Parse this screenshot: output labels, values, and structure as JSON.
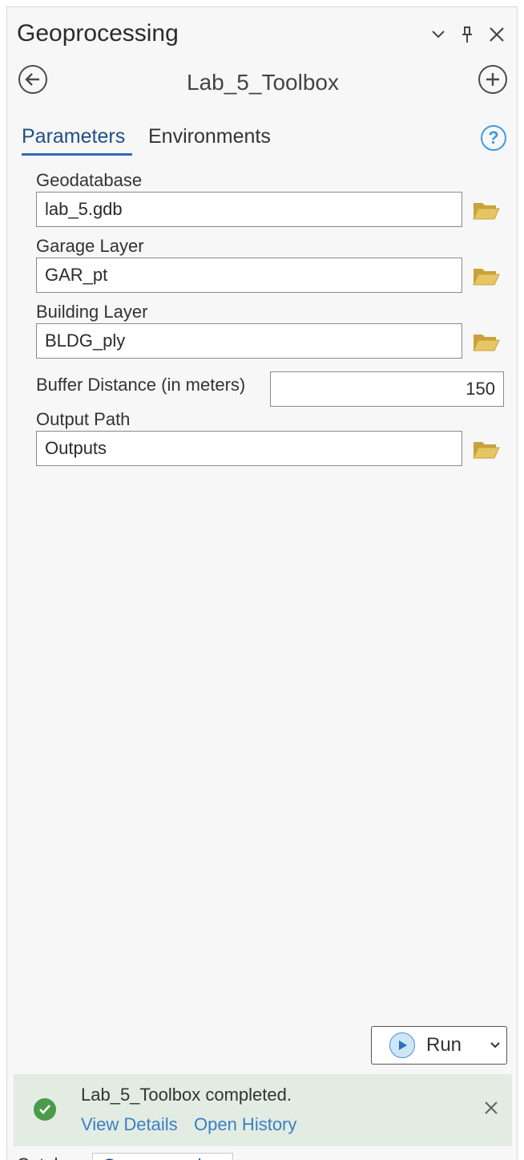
{
  "pane": {
    "title": "Geoprocessing"
  },
  "tool": {
    "title": "Lab_5_Toolbox"
  },
  "tabs": [
    {
      "label": "Parameters",
      "active": true
    },
    {
      "label": "Environments",
      "active": false
    }
  ],
  "params": {
    "geodatabase": {
      "label": "Geodatabase",
      "value": "lab_5.gdb"
    },
    "garage": {
      "label": "Garage Layer",
      "value": "GAR_pt"
    },
    "building": {
      "label": "Building Layer",
      "value": "BLDG_ply"
    },
    "buffer": {
      "label": "Buffer Distance (in meters)",
      "value": "150"
    },
    "output": {
      "label": "Output Path",
      "value": "Outputs"
    }
  },
  "run": {
    "label": "Run"
  },
  "status": {
    "message": "Lab_5_Toolbox completed.",
    "view_details": "View Details",
    "open_history": "Open History"
  },
  "bottom_tabs": [
    {
      "label": "Catalog"
    },
    {
      "label": "Geoprocessing"
    }
  ],
  "icons": {
    "back": "back-arrow-icon",
    "add": "add-icon",
    "help": "help-icon",
    "folder": "folder-icon",
    "run": "play-icon",
    "status": "check-icon"
  },
  "colors": {
    "accent": "#2f6ab0",
    "link": "#3a7fc6",
    "folder": "#d9b64a",
    "success": "#4c9a4c",
    "status_bg": "#e3ece3"
  }
}
